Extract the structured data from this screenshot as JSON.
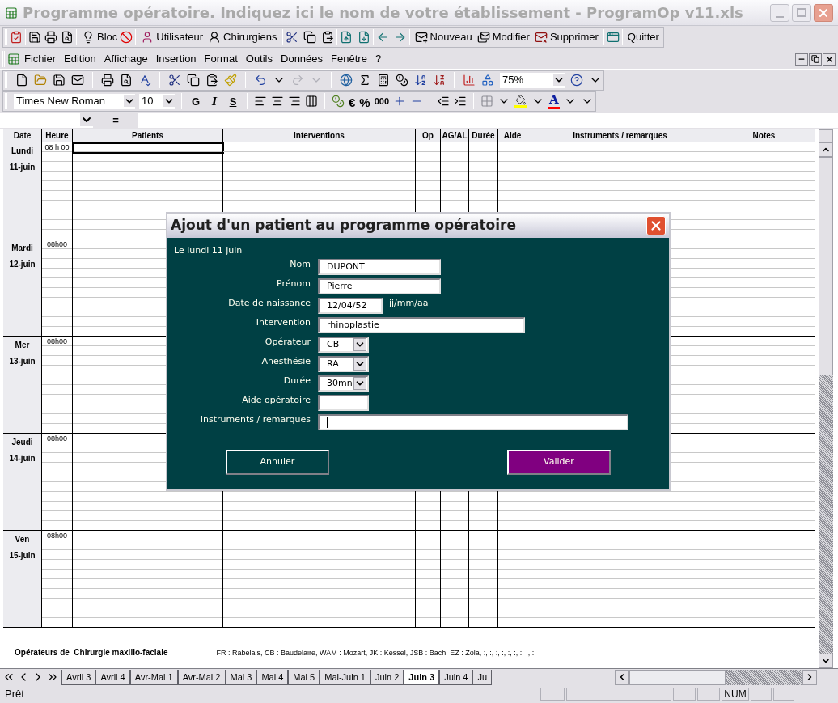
{
  "window": {
    "title": "Programme opératoire. Indiquez ici le nom de votre établissement - ProgramOp v11.xls"
  },
  "custom_toolbar": {
    "buttons": [
      {
        "label": "Bloc"
      },
      {
        "label": "Utilisateur"
      },
      {
        "label": "Chirurgiens"
      },
      {
        "label": "Nouveau"
      },
      {
        "label": "Modifier"
      },
      {
        "label": "Supprimer"
      },
      {
        "label": "Quitter"
      }
    ]
  },
  "menu_bar": {
    "items": [
      "Fichier",
      "Edition",
      "Affichage",
      "Insertion",
      "Format",
      "Outils",
      "Données",
      "Fenêtre",
      "?"
    ]
  },
  "standard_toolbar": {
    "zoom": "75%"
  },
  "format_toolbar": {
    "font": "Times New Roman",
    "size": "10",
    "style_buttons": [
      "G",
      "I",
      "S"
    ],
    "number_buttons": [
      "€",
      "%",
      "000"
    ],
    "font_color_button": "A"
  },
  "formula_bar": {
    "equals": "="
  },
  "sheet": {
    "columns": [
      "Date",
      "Heure",
      "Patients",
      "Interventions",
      "Op",
      "AG/AL",
      "Durée",
      "Aide",
      "Instruments / remarques",
      "Notes"
    ],
    "days": [
      {
        "day": "Lundi",
        "date": "11-juin",
        "time": "08 h 00",
        "patient_cell_selected": true
      },
      {
        "day": "Mardi",
        "date": "12-juin",
        "time": "08h00",
        "patient_cell_selected": false
      },
      {
        "day": "Mer",
        "date": "13-juin",
        "time": "08h00",
        "patient_cell_selected": false
      },
      {
        "day": "Jeudi",
        "date": "14-juin",
        "time": "08h00",
        "patient_cell_selected": false
      },
      {
        "day": "Ven",
        "date": "15-juin",
        "time": "08h00",
        "patient_cell_selected": false
      }
    ],
    "footer": {
      "title": "Opérateurs de  Chirurgie maxillo-faciale",
      "operators": "FR : Rabelais, CB : Baudelaire, WAM : Mozart, JK : Kessel, JSB : Bach, EZ : Zola, :, :, :, :, :, :, :, :, :"
    }
  },
  "sheet_tabs": [
    {
      "label": "Avril 3",
      "selected": false
    },
    {
      "label": "Avril 4",
      "selected": false
    },
    {
      "label": "Avr-Mai 1",
      "selected": false
    },
    {
      "label": "Avr-Mai 2",
      "selected": false
    },
    {
      "label": "Mai 3",
      "selected": false
    },
    {
      "label": "Mai 4",
      "selected": false
    },
    {
      "label": "Mai 5",
      "selected": false
    },
    {
      "label": "Mai-Juin 1",
      "selected": false
    },
    {
      "label": "Juin 2",
      "selected": false
    },
    {
      "label": "Juin 3",
      "selected": true
    },
    {
      "label": "Juin 4",
      "selected": false
    },
    {
      "label": "Ju",
      "selected": false
    }
  ],
  "status_bar": {
    "status": "Prêt",
    "num": "NUM"
  },
  "dialog": {
    "title": "Ajout d'un patient au programme opératoire",
    "date_line": "Le lundi 11 juin",
    "fields": [
      {
        "label": "Nom",
        "kind": "text",
        "value": "DUPONT",
        "focused": false
      },
      {
        "label": "Prénom",
        "kind": "text",
        "value": "Pierre",
        "focused": false
      },
      {
        "label": "Date de naissance",
        "kind": "text",
        "value": "12/04/52",
        "hint": "jj/mm/aa",
        "focused": false
      },
      {
        "label": "Intervention",
        "kind": "text",
        "value": "rhinoplastie",
        "focused": false
      },
      {
        "label": "Opérateur",
        "kind": "combo",
        "value": "CB",
        "focused": false
      },
      {
        "label": "Anesthésie",
        "kind": "combo",
        "value": "RA",
        "focused": false
      },
      {
        "label": "Durée",
        "kind": "combo",
        "value": "30mn",
        "focused": false
      },
      {
        "label": "Aide opératoire",
        "kind": "text",
        "focused": false
      },
      {
        "label": "Instruments / remarques",
        "kind": "text",
        "focused": true
      }
    ],
    "buttons": [
      {
        "label": "Annuler",
        "default": false
      },
      {
        "label": "Valider",
        "default": true
      }
    ]
  }
}
